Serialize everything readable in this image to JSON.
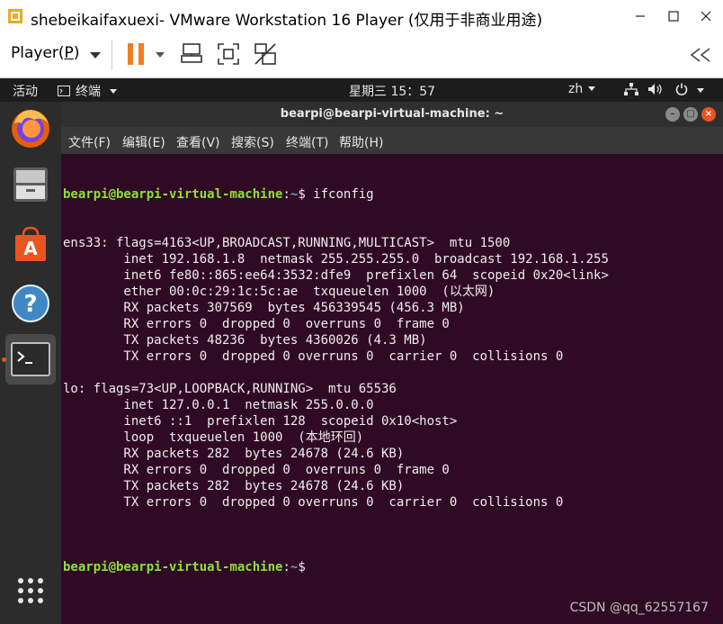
{
  "window": {
    "title": "shebeikaifaxuexi- VMware Workstation 16 Player (仅用于非商业用途)",
    "controls": [
      "minimize",
      "maximize",
      "close"
    ]
  },
  "player_bar": {
    "menu_label_prefix": "Player(",
    "menu_label_accel": "P",
    "menu_label_suffix": ")",
    "icons": [
      "pause-icon",
      "send-ctrl-alt-del-icon",
      "fit-guest-icon",
      "unity-icon",
      "collapse-icon"
    ]
  },
  "ubuntu_topbar": {
    "activities": "活动",
    "app_menu": "终端",
    "clock": "星期三 15：57",
    "input_method": "zh"
  },
  "dock": {
    "items": [
      "firefox-icon",
      "files-icon",
      "software-icon",
      "help-icon",
      "terminal-icon",
      "show-apps-icon"
    ]
  },
  "terminal": {
    "title": "bearpi@bearpi-virtual-machine: ~",
    "menu": [
      "文件(F)",
      "编辑(E)",
      "查看(V)",
      "搜索(S)",
      "终端(T)",
      "帮助(H)"
    ],
    "prompt_user": "bearpi@bearpi-virtual-machine",
    "prompt_sep": ":",
    "prompt_path": "~",
    "prompt_end": "$ ",
    "command": "ifconfig",
    "output": [
      "ens33: flags=4163<UP,BROADCAST,RUNNING,MULTICAST>  mtu 1500",
      "        inet 192.168.1.8  netmask 255.255.255.0  broadcast 192.168.1.255",
      "        inet6 fe80::865:ee64:3532:dfe9  prefixlen 64  scopeid 0x20<link>",
      "        ether 00:0c:29:1c:5c:ae  txqueuelen 1000  (以太网)",
      "        RX packets 307569  bytes 456339545 (456.3 MB)",
      "        RX errors 0  dropped 0  overruns 0  frame 0",
      "        TX packets 48236  bytes 4360026 (4.3 MB)",
      "        TX errors 0  dropped 0 overruns 0  carrier 0  collisions 0",
      "",
      "lo: flags=73<UP,LOOPBACK,RUNNING>  mtu 65536",
      "        inet 127.0.0.1  netmask 255.0.0.0",
      "        inet6 ::1  prefixlen 128  scopeid 0x10<host>",
      "        loop  txqueuelen 1000  (本地环回)",
      "        RX packets 282  bytes 24678 (24.6 KB)",
      "        RX errors 0  dropped 0  overruns 0  frame 0",
      "        TX packets 282  bytes 24678 (24.6 KB)",
      "        TX errors 0  dropped 0 overruns 0  carrier 0  collisions 0",
      ""
    ]
  },
  "watermark": "CSDN @qq_62557167"
}
